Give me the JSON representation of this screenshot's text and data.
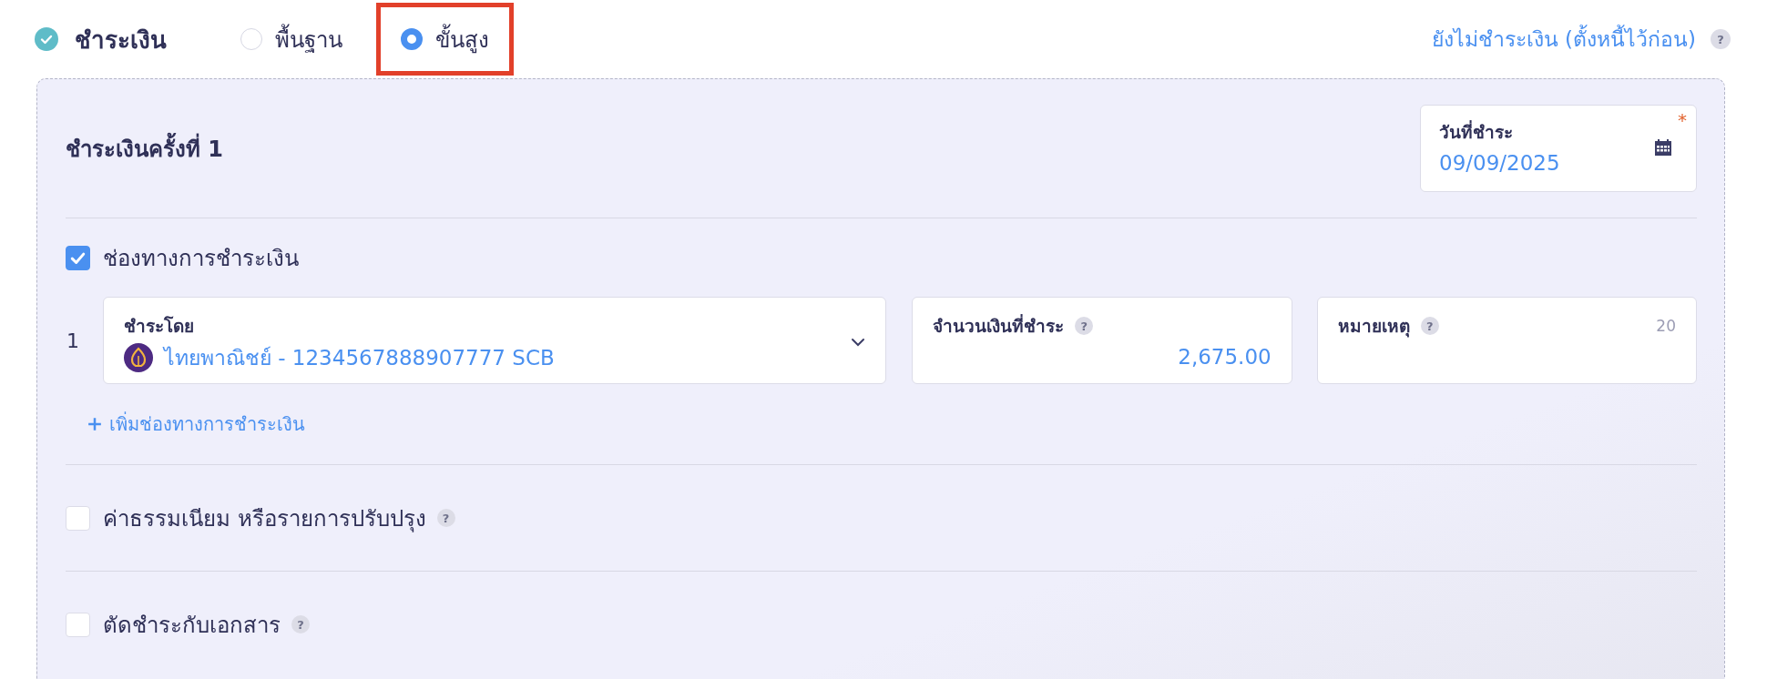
{
  "header": {
    "title": "ชำระเงิน",
    "done": true,
    "modes": [
      {
        "label": "พื้นฐาน",
        "selected": false,
        "highlighted": false
      },
      {
        "label": "ขั้นสูง",
        "selected": true,
        "highlighted": true
      }
    ],
    "defer_link": "ยังไม่ชำระเงิน (ตั้งหนี้ไว้ก่อน)",
    "help": "?"
  },
  "payment": {
    "title": "ชำระเงินครั้งที่ 1",
    "date_field": {
      "label": "วันที่ชำระ",
      "value": "09/09/2025",
      "required": true,
      "required_mark": "*"
    },
    "channels": {
      "label": "ช่องทางการชำระเงิน",
      "checked": true,
      "rows": [
        {
          "index": "1",
          "pay_by": {
            "label": "ชำระโดย",
            "value": "ไทยพาณิชย์ - 1234567888907777 SCB"
          },
          "amount": {
            "label": "จำนวนเงินที่ชำระ",
            "help": "?",
            "value": "2,675.00"
          },
          "note": {
            "label": "หมายเหตุ",
            "help": "?",
            "counter": "20"
          }
        }
      ],
      "add_link": "เพิ่มช่องทางการชำระเงิน"
    },
    "options": [
      {
        "label": "ค่าธรรมเนียม หรือรายการปรับปรุง",
        "checked": false,
        "help": "?"
      },
      {
        "label": "ตัดชำระกับเอกสาร",
        "checked": false,
        "help": "?"
      }
    ]
  }
}
